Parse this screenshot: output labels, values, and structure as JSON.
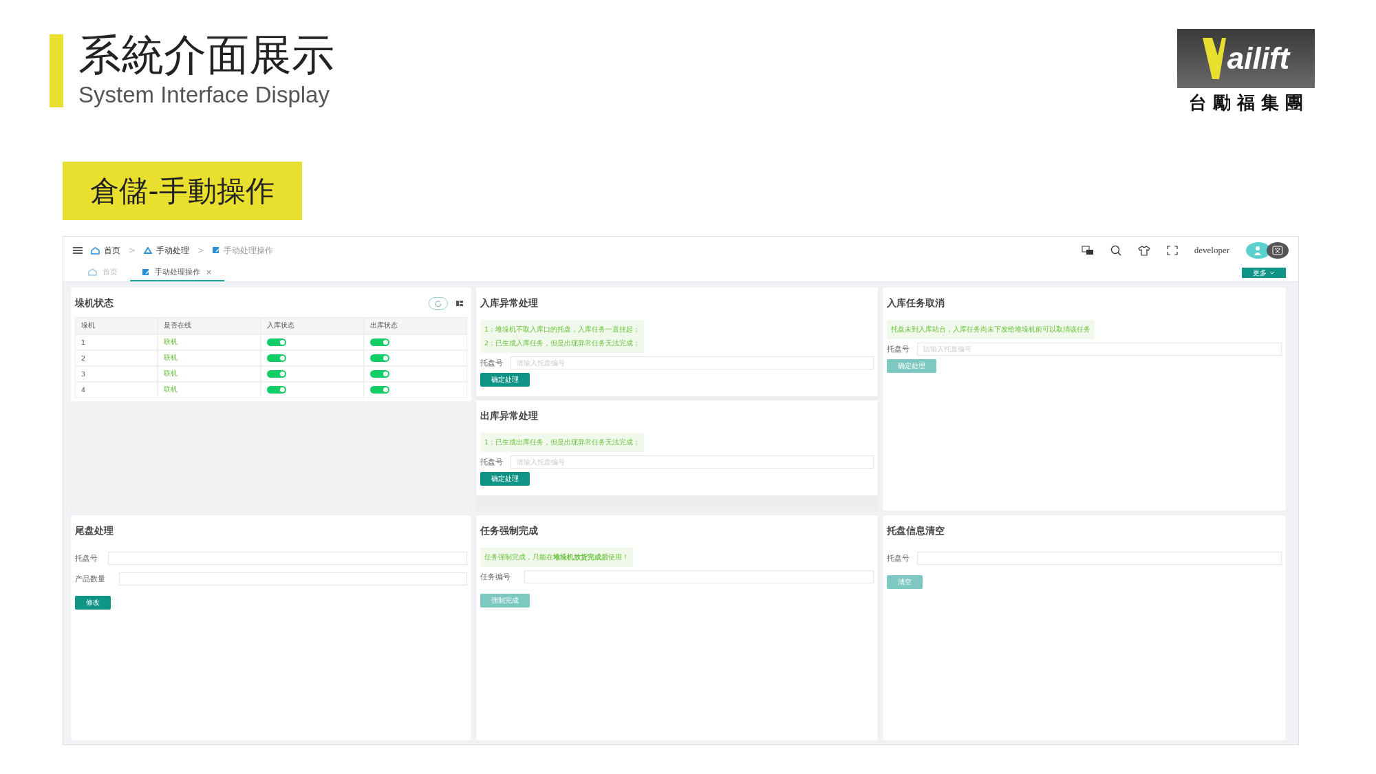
{
  "slide": {
    "title": "系統介面展示",
    "subtitle": "System Interface Display",
    "logo": {
      "wordmark": "ailift",
      "company": "台 勵 福 集 團"
    },
    "label": "倉儲-手動操作"
  },
  "app": {
    "breadcrumbs": [
      {
        "label": "首页"
      },
      {
        "label": "手动处理"
      },
      {
        "label": "手动处理操作"
      }
    ],
    "breadcrumb_separator": ">",
    "user": "developer",
    "tabs": [
      {
        "label": "首页",
        "selected": false
      },
      {
        "label": "手动处理操作",
        "selected": true,
        "close": "×"
      }
    ],
    "more_button": "更多",
    "stacker_panel": {
      "title": "垛机状态",
      "columns": [
        "垛机",
        "是否在线",
        "入库状态",
        "出库状态"
      ],
      "rows": [
        {
          "id": "1",
          "status": "联机",
          "inbound_on": true,
          "outbound_on": true
        },
        {
          "id": "2",
          "status": "联机",
          "inbound_on": true,
          "outbound_on": true
        },
        {
          "id": "3",
          "status": "联机",
          "inbound_on": true,
          "outbound_on": true
        },
        {
          "id": "4",
          "status": "联机",
          "inbound_on": true,
          "outbound_on": true
        }
      ]
    },
    "forms": [
      {
        "title": "入库异常处理",
        "notes": [
          "1：堆垛机不取入库口的托盘，入库任务一直挂起；",
          "2：已生成入库任务，但是出现异常任务无法完成；"
        ],
        "fields": [
          {
            "label": "托盘号",
            "placeholder": "请输入托盘编号"
          }
        ],
        "button": {
          "label": "确定处理",
          "disabled": false
        }
      },
      {
        "title": "出库异常处理",
        "notes": [
          "1：已生成出库任务，但是出现异常任务无法完成；"
        ],
        "fields": [
          {
            "label": "托盘号",
            "placeholder": "请输入托盘编号"
          }
        ],
        "button": {
          "label": "确定处理",
          "disabled": false
        }
      },
      {
        "title": "入库任务取消",
        "notes": [
          "托盘未到入库站台，入库任务尚未下发给堆垛机前可以取消该任务"
        ],
        "fields": [
          {
            "label": "托盘号",
            "placeholder": "請输入托盘编号"
          }
        ],
        "button": {
          "label": "确定处理",
          "disabled": true
        }
      },
      {
        "title": "尾盘处理",
        "fields": [
          {
            "label": "托盘号"
          },
          {
            "label": "产品数量"
          }
        ],
        "button": {
          "label": "修改",
          "disabled": false
        }
      },
      {
        "title": "任务强制完成",
        "notes": [
          "任务强制完成，只能在**堆垛机放货完成后**使用！"
        ],
        "fields": [
          {
            "label": "任务编号"
          }
        ],
        "button": {
          "label": "强制完成",
          "disabled": true
        }
      },
      {
        "title": "托盘信息清空",
        "fields": [
          {
            "label": "托盘号"
          }
        ],
        "button": {
          "label": "清空",
          "disabled": true
        }
      }
    ]
  }
}
